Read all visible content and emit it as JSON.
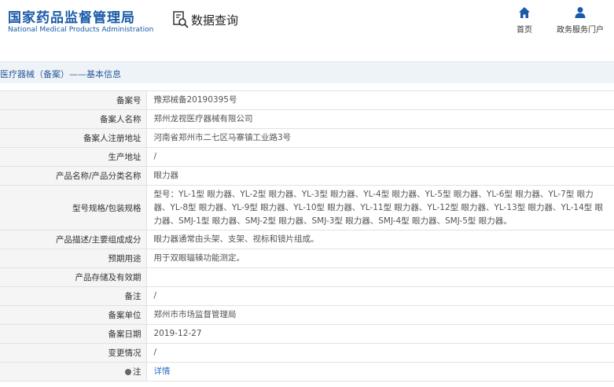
{
  "header": {
    "logo_cn": "国家药品监督管理局",
    "logo_en": "National Medical Products Administration",
    "query_title": "数据查询",
    "nav": [
      {
        "label": "首页",
        "icon": "home-icon"
      },
      {
        "label": "政务服务门户",
        "icon": "user-icon"
      }
    ]
  },
  "breadcrumb": "医疗器械（备案）——基本信息",
  "rows": [
    {
      "key": "备案号",
      "value": "豫郑械备20190395号"
    },
    {
      "key": "备案人名称",
      "value": "郑州龙视医疗器械有限公司"
    },
    {
      "key": "备案人注册地址",
      "value": "河南省郑州市二七区马寨镇工业路3号"
    },
    {
      "key": "生产地址",
      "value": "/"
    },
    {
      "key": "产品名称/产品分类名称",
      "value": "眼力器"
    },
    {
      "key": "型号规格/包装规格",
      "value": "型号：YL-1型 眼力器、YL-2型 眼力器、YL-3型 眼力器、YL-4型 眼力器、YL-5型 眼力器、YL-6型 眼力器、YL-7型 眼力器、YL-8型 眼力器、YL-9型 眼力器、YL-10型 眼力器、YL-11型 眼力器、YL-12型 眼力器、YL-13型 眼力器、YL-14型 眼力器、SMJ-1型 眼力器、SMJ-2型 眼力器、SMJ-3型 眼力器、SMJ-4型 眼力器、SMJ-5型 眼力器。"
    },
    {
      "key": "产品描述/主要组成成分",
      "value": "眼力器通常由头架、支架、视标和镜片组成。"
    },
    {
      "key": "预期用途",
      "value": "用于双眼辐辏功能测定。"
    },
    {
      "key": "产品存储及有效期",
      "value": ""
    },
    {
      "key": "备注",
      "value": "/"
    },
    {
      "key": "备案单位",
      "value": "郑州市市场监督管理局"
    },
    {
      "key": "备案日期",
      "value": "2019-12-27"
    },
    {
      "key": "变更情况",
      "value": "/"
    },
    {
      "key": "注",
      "value": "详情"
    }
  ],
  "colors": {
    "brand": "#1a5aa8",
    "link": "#2a6fc4",
    "key_bg": "#f5f5f5",
    "breadcrumb_bg": "#eef3f8"
  }
}
